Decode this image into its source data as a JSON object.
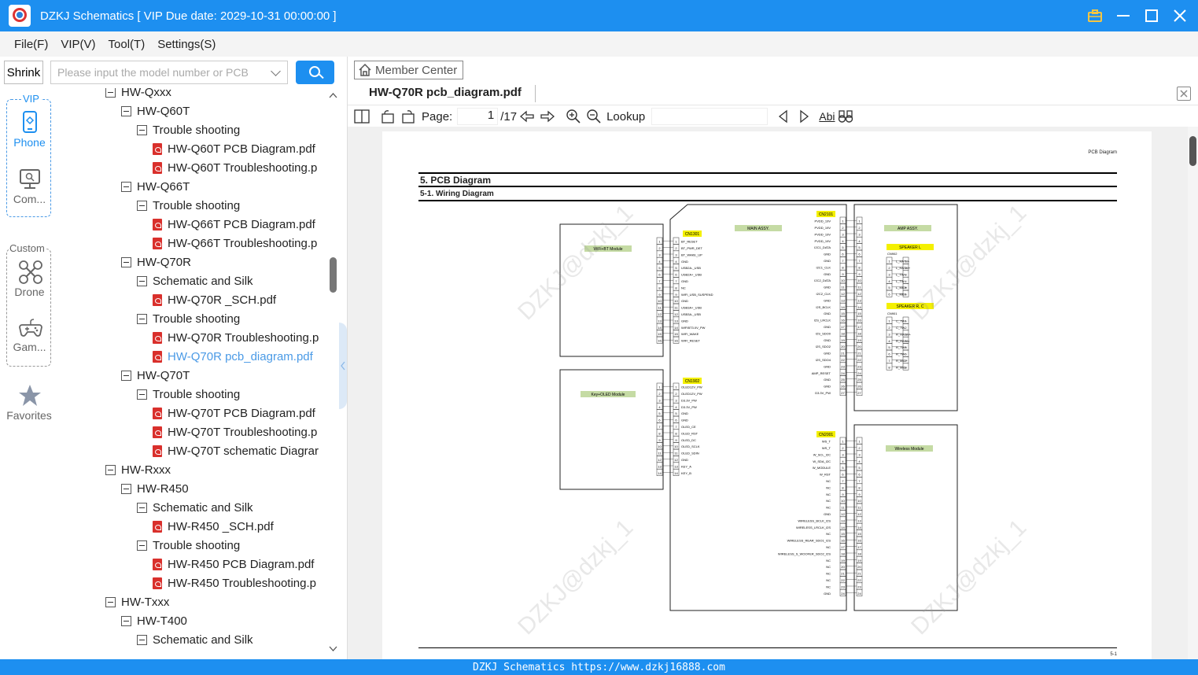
{
  "window": {
    "title": "DZKJ Schematics [ VIP Due date: 2029-10-31 00:00:00 ]"
  },
  "menu": [
    "File(F)",
    "VIP(V)",
    "Tool(T)",
    "Settings(S)"
  ],
  "search": {
    "shrink_label": "Shrink",
    "placeholder": "Please input the model number or PCB"
  },
  "leftnav": {
    "vip_label": "VIP",
    "phone": "Phone",
    "computer": "Com...",
    "custom_label": "Custom",
    "drone": "Drone",
    "game": "Gam...",
    "favorites": "Favorites"
  },
  "tree": [
    {
      "level": 0,
      "kind": "folder",
      "label": "HW-Qxxx"
    },
    {
      "level": 1,
      "kind": "folder",
      "label": "HW-Q60T"
    },
    {
      "level": 2,
      "kind": "folder",
      "label": "Trouble shooting"
    },
    {
      "level": 3,
      "kind": "pdf",
      "label": "HW-Q60T PCB Diagram.pdf"
    },
    {
      "level": 3,
      "kind": "pdf",
      "label": "HW-Q60T Troubleshooting.p"
    },
    {
      "level": 1,
      "kind": "folder",
      "label": "HW-Q66T"
    },
    {
      "level": 2,
      "kind": "folder",
      "label": "Trouble shooting"
    },
    {
      "level": 3,
      "kind": "pdf",
      "label": "HW-Q66T PCB Diagram.pdf"
    },
    {
      "level": 3,
      "kind": "pdf",
      "label": "HW-Q66T Troubleshooting.p"
    },
    {
      "level": 1,
      "kind": "folder",
      "label": "HW-Q70R"
    },
    {
      "level": 2,
      "kind": "folder",
      "label": "Schematic and Silk"
    },
    {
      "level": 3,
      "kind": "pdf",
      "label": "HW-Q70R _SCH.pdf"
    },
    {
      "level": 2,
      "kind": "folder",
      "label": "Trouble shooting"
    },
    {
      "level": 3,
      "kind": "pdf",
      "label": "HW-Q70R Troubleshooting.p"
    },
    {
      "level": 3,
      "kind": "pdf",
      "label": "HW-Q70R pcb_diagram.pdf",
      "active": true
    },
    {
      "level": 1,
      "kind": "folder",
      "label": "HW-Q70T"
    },
    {
      "level": 2,
      "kind": "folder",
      "label": "Trouble shooting"
    },
    {
      "level": 3,
      "kind": "pdf",
      "label": "HW-Q70T PCB Diagram.pdf"
    },
    {
      "level": 3,
      "kind": "pdf",
      "label": "HW-Q70T Troubleshooting.p"
    },
    {
      "level": 3,
      "kind": "pdf",
      "label": "HW-Q70T schematic Diagrar"
    },
    {
      "level": 0,
      "kind": "folder",
      "label": "HW-Rxxx"
    },
    {
      "level": 1,
      "kind": "folder",
      "label": "HW-R450"
    },
    {
      "level": 2,
      "kind": "folder",
      "label": "Schematic and Silk"
    },
    {
      "level": 3,
      "kind": "pdf",
      "label": "HW-R450 _SCH.pdf"
    },
    {
      "level": 2,
      "kind": "folder",
      "label": "Trouble shooting"
    },
    {
      "level": 3,
      "kind": "pdf",
      "label": "HW-R450 PCB Diagram.pdf"
    },
    {
      "level": 3,
      "kind": "pdf",
      "label": "HW-R450 Troubleshooting.p"
    },
    {
      "level": 0,
      "kind": "folder",
      "label": "HW-Txxx"
    },
    {
      "level": 1,
      "kind": "folder",
      "label": "HW-T400"
    },
    {
      "level": 2,
      "kind": "folder",
      "label": "Schematic and Silk"
    }
  ],
  "viewer": {
    "member_center": "Member Center",
    "tab_title": "HW-Q70R pcb_diagram.pdf",
    "page_label": "Page:",
    "page_current": "1",
    "page_total": "/17",
    "lookup_label": "Lookup",
    "abi_label": "Abi"
  },
  "pdf": {
    "header_right": "PCB Diagram",
    "section_title": "5.  PCB Diagram",
    "subsection_title": "5-1.  Wiring Diagram",
    "footer_page": "5-1",
    "watermark": "DZKJ@dzkj_1",
    "modules": {
      "wifi": "WiFi+BT Module",
      "key": "Key+OLED Module",
      "main": "MAIN ASSY.",
      "amp": "AMP ASSY.",
      "wireless": "Wireless Module",
      "cn1301": "CN1301",
      "cn1902": "CN1902",
      "cn2101": "CN2101",
      "cn2001": "CN2001",
      "speaker_l": "SPEAKER L",
      "speaker_rc": "SPEAKER R, C",
      "cn902": "CN902",
      "cn901": "CN901"
    },
    "pins": {
      "cn1301": [
        "BT_RESET",
        "BT_PWR_DET",
        "BT_WAKE_UP",
        "GND",
        "USB2A-_USB",
        "USB2A+_USB",
        "GND",
        "NC",
        "WIFI_USB_SUSPEND",
        "GND",
        "USB3A+_USB",
        "USB3A-_USB",
        "GND",
        "WIFIBT3.0V_PW",
        "WIFI_WAKE",
        "WIFI_RESET"
      ],
      "cn1902": [
        "OLED12V_PW",
        "OLED12V_PW",
        "D3.3V_PW",
        "D3.3V_PW",
        "GND",
        "GND",
        "OLED_CE",
        "OLED_RST",
        "OLED_DC",
        "OLED_SCLK",
        "OLED_SDIN",
        "GND",
        "KEY_A",
        "KEY_B"
      ],
      "cn2101": [
        "PVDD_19V",
        "PVDD_19V",
        "PVDD_19V",
        "PVDD_19V",
        "I2C1_DATA",
        "GND",
        "GND",
        "I2C1_CLK",
        "GND",
        "I2C2_DATA",
        "GND",
        "I2C2_CLK",
        "GND",
        "I2S_BCLK",
        "GND",
        "I2S_LRCLK",
        "GND",
        "I2S_SDO0",
        "GND",
        "I2S_SDO2",
        "GND",
        "I2S_SDO4",
        "GND",
        "AMP_RESET",
        "GND",
        "GND",
        "D3.3V_PW"
      ],
      "cn2001": [
        "WS_T",
        "WS_T",
        "W_SCL_I2C",
        "W_SDA_I2C",
        "W_MODULE",
        "W_RST",
        "NC",
        "NC",
        "NC",
        "NC",
        "NC",
        "GND",
        "WIRELESS_BCLK_I2S",
        "WIRELESS_LRCLK_I2S",
        "NC",
        "WIRELESS_REAR_SDO1_I2S",
        "NC",
        "WIRELESS_S_WOOFER_SDO2_I2S",
        "NC",
        "NC",
        "NC",
        "NC",
        "NC",
        "GND"
      ],
      "cn902": [
        "L_HATW-",
        "L_HATW+",
        "L_TW+",
        "L_TW-",
        "L_MID+",
        "L_MID-"
      ],
      "cn901": [
        "C_TW+",
        "C_TW-",
        "R_HATW+",
        "R_HATW-",
        "R_TW+",
        "R_TW-",
        "R_MID+",
        "R_MID-"
      ]
    }
  },
  "status_bar": "DZKJ Schematics https://www.dzkj16888.com",
  "colors": {
    "accent": "#1d8ff0",
    "pdf_icon": "#d9302c",
    "active_link": "#4a9ae6",
    "label_bg": "#c5dba4",
    "connector_bg": "#f4f000"
  }
}
